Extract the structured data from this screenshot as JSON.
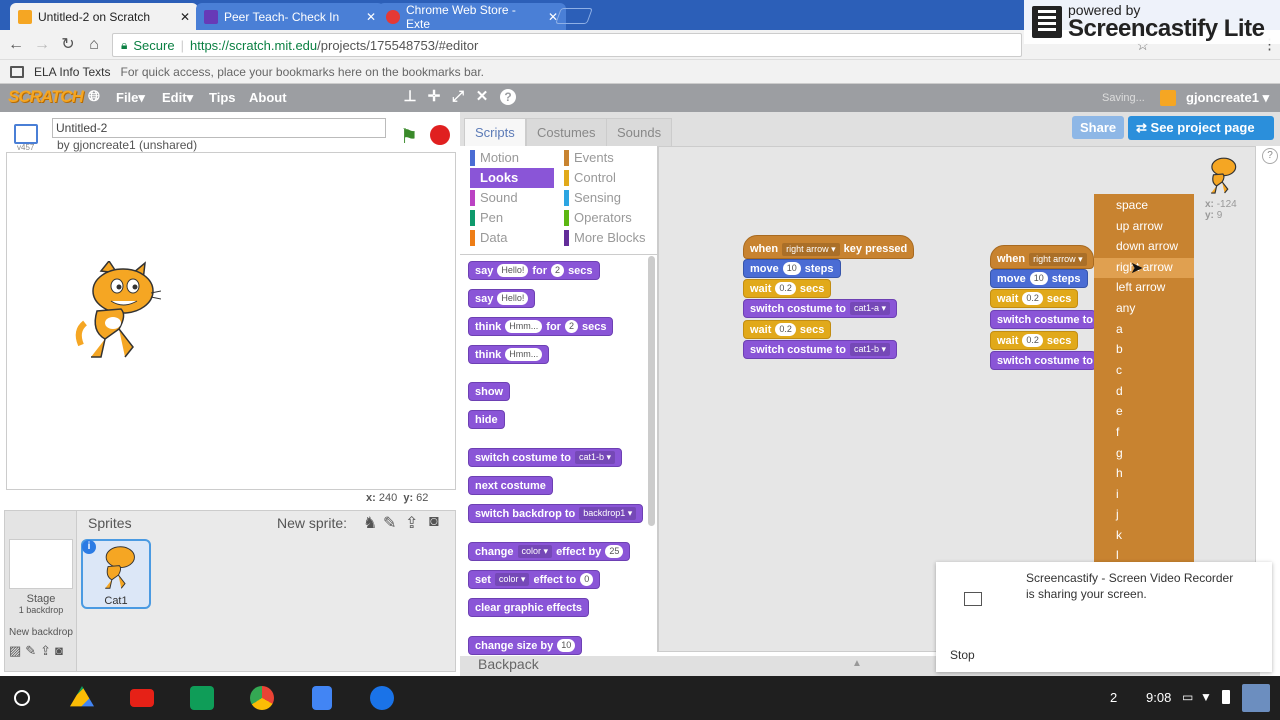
{
  "browser": {
    "tabs": [
      {
        "title": "Untitled-2 on Scratch",
        "favicon_color": "#f5a623"
      },
      {
        "title": "Peer Teach- Check In",
        "favicon_color": "#673ab7"
      },
      {
        "title": "Chrome Web Store - Exte",
        "favicon_color": "#e53935"
      }
    ],
    "secure_label": "Secure",
    "url_host": "https://scratch.mit.edu",
    "url_path": "/projects/175548753/#editor",
    "bookmark_folder": "ELA Info Texts",
    "bookmark_hint": "For quick access, place your bookmarks here on the bookmarks bar."
  },
  "screencastify": {
    "powered_by": "powered by",
    "brand": "Screencastify Lite"
  },
  "scratch": {
    "logo": "SCRATCH",
    "menu": [
      "File",
      "Edit",
      "Tips",
      "About"
    ],
    "saving": "Saving...",
    "username": "gjoncreate1",
    "project_title": "Untitled-2",
    "byline": "by gjoncreate1 (unshared)",
    "version": "v457",
    "share": "Share",
    "see_project": "See project page",
    "coords": {
      "x_label": "x:",
      "x": "240",
      "y_label": "y:",
      "y": "62"
    },
    "sprite_coords": {
      "x_label": "x:",
      "x": "-124",
      "y_label": "y:",
      "y": "9"
    },
    "tabs": [
      "Scripts",
      "Costumes",
      "Sounds"
    ],
    "categories_left": [
      {
        "label": "Motion",
        "color": "#4a6cd4"
      },
      {
        "label": "Looks",
        "color": "#8a55d7"
      },
      {
        "label": "Sound",
        "color": "#bb42c3"
      },
      {
        "label": "Pen",
        "color": "#0e9a6c"
      },
      {
        "label": "Data",
        "color": "#ee7d16"
      }
    ],
    "categories_right": [
      {
        "label": "Events",
        "color": "#c88330"
      },
      {
        "label": "Control",
        "color": "#e1a91a"
      },
      {
        "label": "Sensing",
        "color": "#2ca5e2"
      },
      {
        "label": "Operators",
        "color": "#5cb712"
      },
      {
        "label": "More Blocks",
        "color": "#632d99"
      }
    ],
    "palette": {
      "say_for": {
        "say": "say",
        "text": "Hello!",
        "for": "for",
        "num": "2",
        "secs": "secs"
      },
      "say": {
        "say": "say",
        "text": "Hello!"
      },
      "think_for": {
        "think": "think",
        "text": "Hmm...",
        "for": "for",
        "num": "2",
        "secs": "secs"
      },
      "think": {
        "think": "think",
        "text": "Hmm..."
      },
      "show": "show",
      "hide": "hide",
      "switch_costume": {
        "label": "switch costume to",
        "value": "cat1-b"
      },
      "next_costume": "next costume",
      "switch_backdrop": {
        "label": "switch backdrop to",
        "value": "backdrop1"
      },
      "change_effect": {
        "change": "change",
        "effect": "color",
        "by_label": "effect by",
        "value": "25"
      },
      "set_effect": {
        "set": "set",
        "effect": "color",
        "to_label": "effect to",
        "value": "0"
      },
      "clear_effects": "clear graphic effects",
      "change_size": {
        "label": "change size by",
        "value": "10"
      }
    },
    "script1": {
      "when": "when",
      "key": "right arrow",
      "pressed": "key pressed",
      "move": "move",
      "steps_val": "10",
      "steps": "steps",
      "wait": "wait",
      "wait_val": "0.2",
      "secs": "secs",
      "switch": "switch costume to",
      "costume_a": "cat1-a",
      "costume_b": "cat1-b"
    },
    "script2": {
      "when": "when",
      "key": "right arrow",
      "move": "move",
      "steps_val": "10",
      "steps": "steps",
      "wait": "wait",
      "wait_val": "0.2",
      "secs": "secs",
      "switch": "switch costume to"
    },
    "key_dropdown": [
      "space",
      "up arrow",
      "down arrow",
      "right arrow",
      "left arrow",
      "any",
      "a",
      "b",
      "c",
      "d",
      "e",
      "f",
      "g",
      "h",
      "i",
      "j",
      "k",
      "l"
    ],
    "sprites_header": "Sprites",
    "new_sprite": "New sprite:",
    "stage_label": "Stage",
    "stage_backdrops": "1 backdrop",
    "new_backdrop": "New backdrop",
    "sprite_name": "Cat1",
    "backpack": "Backpack"
  },
  "notification": {
    "title": "Screencastify - Screen Video Recorder",
    "body": "is sharing your screen.",
    "stop": "Stop"
  },
  "shelf": {
    "badge": "2",
    "time": "9:08"
  }
}
